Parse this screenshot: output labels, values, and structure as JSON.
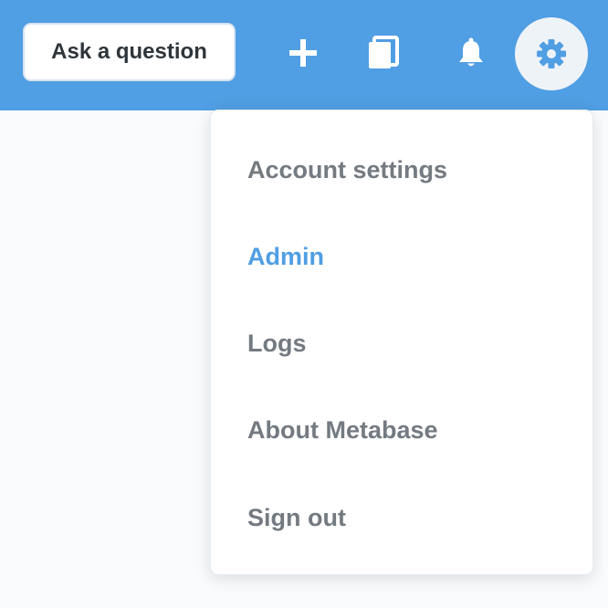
{
  "header": {
    "ask_label": "Ask a question",
    "icons": {
      "plus": "plus-icon",
      "collection": "collection-icon",
      "bell": "bell-icon",
      "gear": "gear-icon"
    }
  },
  "dropdown": {
    "items": [
      {
        "label": "Account settings",
        "active": false
      },
      {
        "label": "Admin",
        "active": true
      },
      {
        "label": "Logs",
        "active": false
      },
      {
        "label": "About Metabase",
        "active": false
      },
      {
        "label": "Sign out",
        "active": false
      }
    ]
  },
  "colors": {
    "brand": "#509ee3",
    "text_dark": "#2e353b",
    "text_muted": "#747a81",
    "background": "#f9fbfd"
  }
}
